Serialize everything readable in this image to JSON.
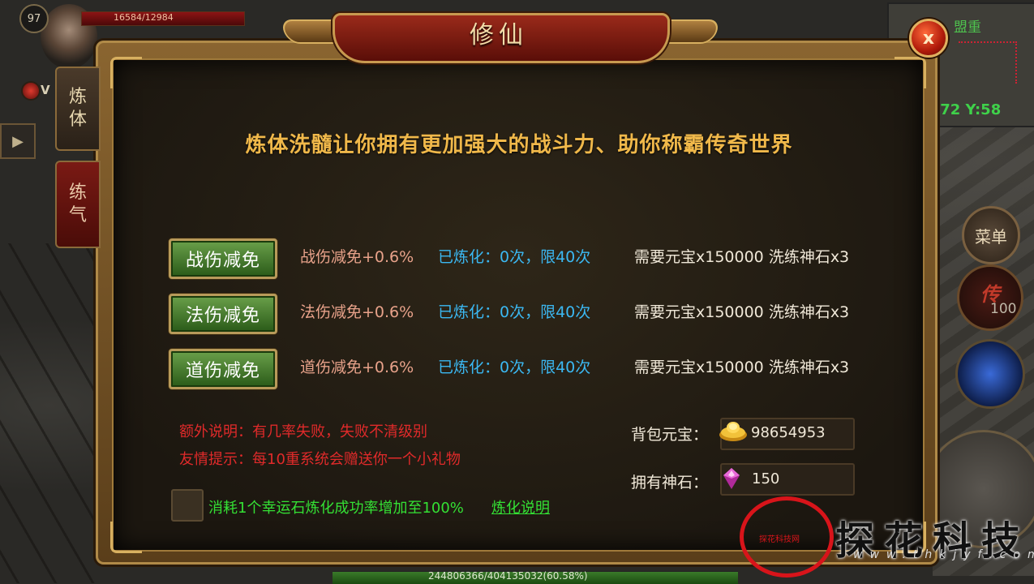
{
  "hud": {
    "level": "97",
    "hp_text": "16584/12984",
    "v_tag": "V",
    "play_glyph": "▶"
  },
  "side_tabs": [
    {
      "label_line1": "炼",
      "label_line2": "体",
      "active": false
    },
    {
      "label_line1": "练",
      "label_line2": "气",
      "active": true
    }
  ],
  "minimap": {
    "name": "盟重",
    "coords": ":72  Y:58"
  },
  "right_buttons": {
    "menu_label": "菜单",
    "chuan_glyph": "传",
    "chuan_count": "100"
  },
  "exp_bar": {
    "text": "244806366/404135032(60.58%)",
    "progress": 0.6058
  },
  "dialog": {
    "title": "修仙",
    "close_glyph": "x",
    "headline": "炼体洗髓让你拥有更加强大的战斗力、助你称霸传奇世界",
    "rows": [
      {
        "button": "战伤减免",
        "effect": "战伤减免+0.6%",
        "done": "已炼化：0次，限40次",
        "cost": "需要元宝x150000 洗练神石x3"
      },
      {
        "button": "法伤减免",
        "effect": "法伤减免+0.6%",
        "done": "已炼化：0次，限40次",
        "cost": "需要元宝x150000 洗练神石x3"
      },
      {
        "button": "道伤减免",
        "effect": "道伤减免+0.6%",
        "done": "已炼化：0次，限40次",
        "cost": "需要元宝x150000 洗练神石x3"
      }
    ],
    "note_extra": "额外说明：有几率失败，失败不清级别",
    "note_tip": "友情提示：每10重系统会赠送你一个小礼物",
    "luck_text": "消耗1个幸运石炼化成功率增加至100%",
    "luck_link": "炼化说明",
    "gold_label": "背包元宝：",
    "gold_value": "98654953",
    "stone_label": "拥有神石：",
    "stone_value": "150"
  },
  "watermark": {
    "small": "探花科技网",
    "big": "探花科技",
    "url": "www.thkjyf.com"
  },
  "colors": {
    "effect": "#e8a28a",
    "done": "#3bb8f2",
    "note": "#e02a2a",
    "luck": "#34e034",
    "headline": "#f0b84a"
  }
}
